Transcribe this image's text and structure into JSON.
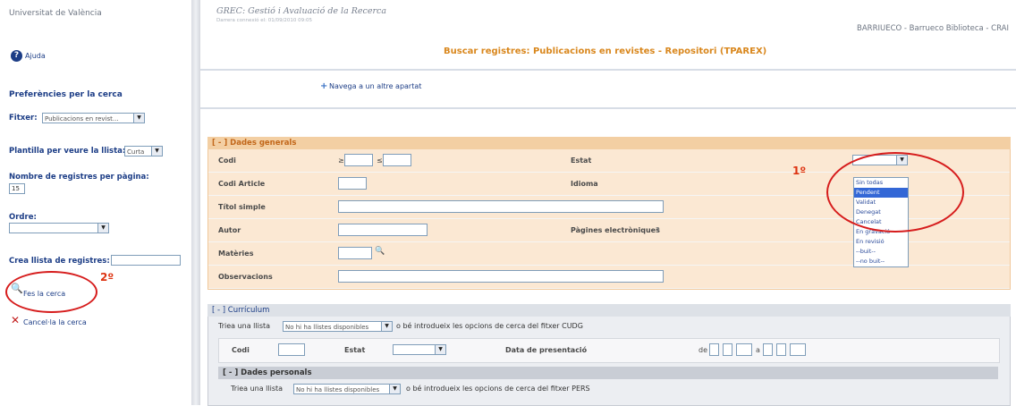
{
  "sidebar": {
    "institution": "Universitat de València",
    "help": "Ajuda",
    "help_icon": "help-icon",
    "prefs_title": "Preferències per la cerca",
    "fitxer_label": "Fitxer:",
    "fitxer_value": "Publicacions en revist...",
    "plantilla_label": "Plantilla per veure la llista:",
    "plantilla_value": "Curta",
    "nombre_label": "Nombre de registres per pàgina:",
    "nombre_value": "15",
    "ordre_label": "Ordre:",
    "ordre_value": "",
    "crea_label": "Crea llista de registres:",
    "crea_value": "",
    "search_label": "Fes la cerca",
    "cancel_label": "Cancel·la la cerca",
    "annotation_2": "2º"
  },
  "header": {
    "title": "GREC: Gestió i Avaluació de la Recerca",
    "subtitle": "Darrera connexió el: 01/09/2010 09:05",
    "user": "BARRIUECO - Barrueco Biblioteca - CRAI",
    "page_title": "Buscar registres: Publicacions en revistes - Repositori (TPAREX)"
  },
  "nav": {
    "label": "Navega a un altre apartat"
  },
  "dades_generals": {
    "header": "[ - ] Dades generals",
    "codi": "Codi",
    "codi_from_prefix": "≥",
    "codi_to_prefix": "≤",
    "estat": "Estat",
    "codi_article": "Codi Article",
    "idioma": "Idioma",
    "titol": "Títol simple",
    "autor": "Autor",
    "pagines": "Pàgines electròniques",
    "pagines_q": "?",
    "materies": "Matèries",
    "observacions": "Observacions",
    "estat_value": "",
    "annotation_1": "1º",
    "estat_options": [
      "Sin todas",
      "Pendent",
      "Validat",
      "Denegat",
      "Cancelat",
      "En gravació",
      "En revisió",
      "--buit--",
      "--no buit--"
    ],
    "estat_highlighted": "Pendent"
  },
  "curriculum": {
    "header": "[ - ] Currículum",
    "tria": "Triea una llista",
    "list_value": "No hi ha llistes disponibles",
    "intro": "o bé introdueix les opcions de cerca del fitxer CUDG",
    "codi": "Codi",
    "estat": "Estat",
    "data": "Data de presentació",
    "data_from": "de",
    "data_to": "a"
  },
  "dades_personals": {
    "header": "[ - ] Dades personals",
    "tria": "Triea una llista",
    "list_value": "No hi ha llistes disponibles",
    "intro": "o bé introdueix les opcions de cerca del fitxer PERS"
  },
  "colors": {
    "accent": "#1c3d86",
    "section_orange": "#f3cfa3",
    "annotation_red": "#d61c1c"
  }
}
